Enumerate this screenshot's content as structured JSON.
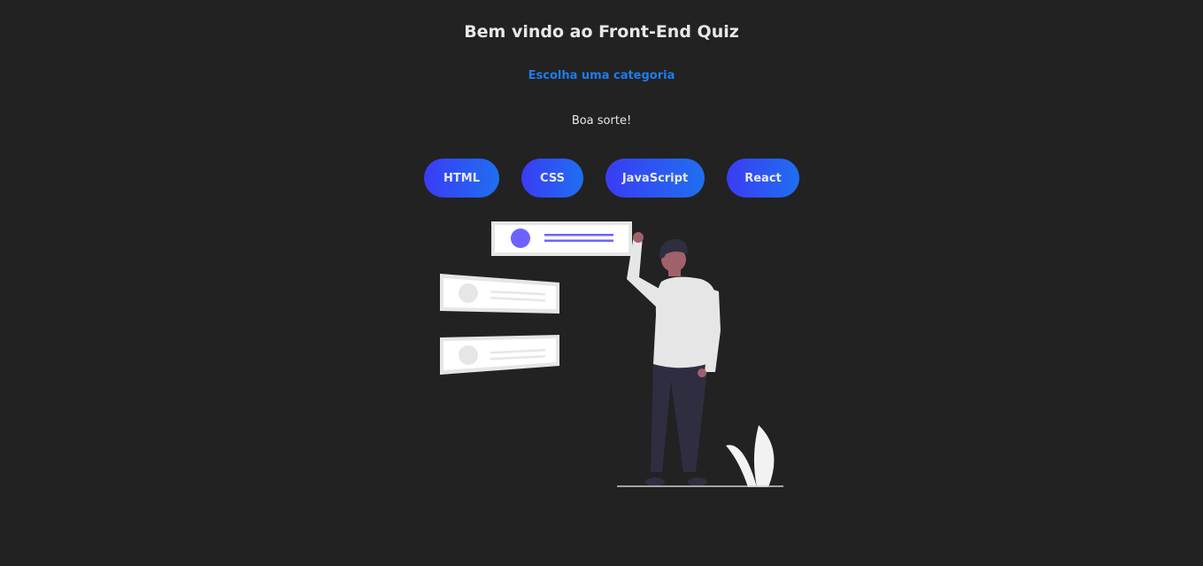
{
  "header": {
    "title": "Bem vindo ao Front-End Quiz",
    "subtitle": "Escolha uma categoria",
    "luck": "Boa sorte!"
  },
  "categories": [
    {
      "label": "HTML"
    },
    {
      "label": "CSS"
    },
    {
      "label": "JavaScript"
    },
    {
      "label": "React"
    }
  ],
  "colors": {
    "background": "#222222",
    "text": "#e8e8e8",
    "accent": "#1d7cf2",
    "button_gradient_start": "#3a3cf5",
    "button_gradient_end": "#1f6ff0",
    "illustration_accent": "#6c63ff"
  },
  "illustration": {
    "icon": "person-with-cards-illustration"
  }
}
